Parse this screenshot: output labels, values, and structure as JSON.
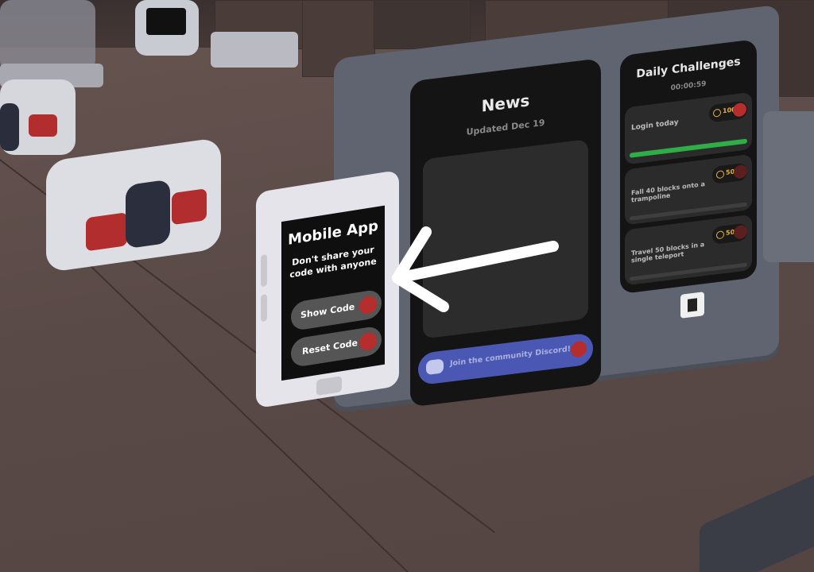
{
  "news": {
    "title": "News",
    "updated": "Updated Dec 19",
    "discord_label": "Join the community Discord!"
  },
  "challenges": {
    "title": "Daily Challenges",
    "timer": "00:00:59",
    "items": [
      {
        "label": "Login today",
        "reward": "100",
        "progress": 1.0
      },
      {
        "label": "Fall 40 blocks onto a trampoline",
        "reward": "50",
        "progress": 0.0
      },
      {
        "label": "Travel 50 blocks in a single teleport",
        "reward": "50",
        "progress": 0.0
      }
    ]
  },
  "mobile_app": {
    "title": "Mobile App",
    "warning": "Don't share your code with anyone",
    "show_code": "Show Code",
    "reset_code": "Reset Code"
  },
  "colors": {
    "button_dot": "#b52d2d",
    "progress_fill": "#2fae47",
    "discord_bar": "#4b58b3",
    "coin": "#e2b13c"
  },
  "icons": {
    "coin": "coin-icon",
    "discord": "discord-icon",
    "arrow": "arrow-left-icon"
  }
}
